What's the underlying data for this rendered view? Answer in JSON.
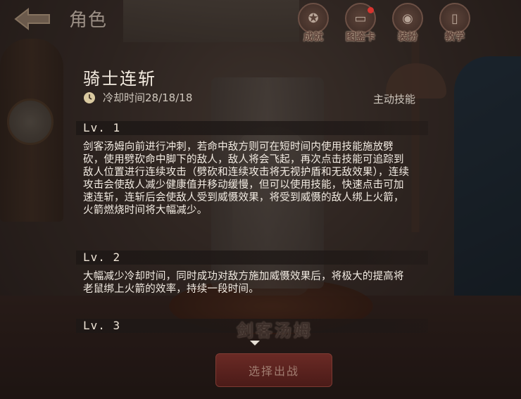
{
  "header": {
    "title": "角色",
    "nav": [
      {
        "label": "成就",
        "icon": "medal-icon",
        "badge": false
      },
      {
        "label": "图鉴卡",
        "icon": "card-icon",
        "badge": true
      },
      {
        "label": "装扮",
        "icon": "outfit-icon",
        "badge": false
      },
      {
        "label": "教学",
        "icon": "book-icon",
        "badge": false
      }
    ]
  },
  "skill": {
    "name": "骑士连斩",
    "cooldown": "冷却时间28/18/18",
    "type": "主动技能",
    "levels": [
      {
        "label": "Lv. 1",
        "desc": "剑客汤姆向前进行冲刺，若命中敌方则可在短时间内使用技能施放劈砍，使用劈砍命中脚下的敌人，敌人将会飞起，再次点击技能可追踪到敌人位置进行连续攻击（劈砍和连续攻击将无视护盾和无敌效果），连续攻击会使敌人减少健康值并移动缓慢，但可以使用技能，快速点击可加速连斩，连斩后会使敌人受到威慑效果，将受到威慑的敌人绑上火箭，火箭燃烧时间将大幅减少。"
      },
      {
        "label": "Lv. 2",
        "desc": "大幅减少冷却时间，同时成功对敌方施加威慑效果后，将极大的提高将老鼠绑上火箭的效率，持续一段时间。"
      },
      {
        "label": "Lv. 3",
        "desc": ""
      }
    ]
  },
  "character": {
    "name": "剑客汤姆"
  },
  "actions": {
    "select_label": "选择出战"
  },
  "colors": {
    "text_primary": "#f3ece3",
    "select_button": "#5a2320",
    "badge": "#d8342f"
  }
}
